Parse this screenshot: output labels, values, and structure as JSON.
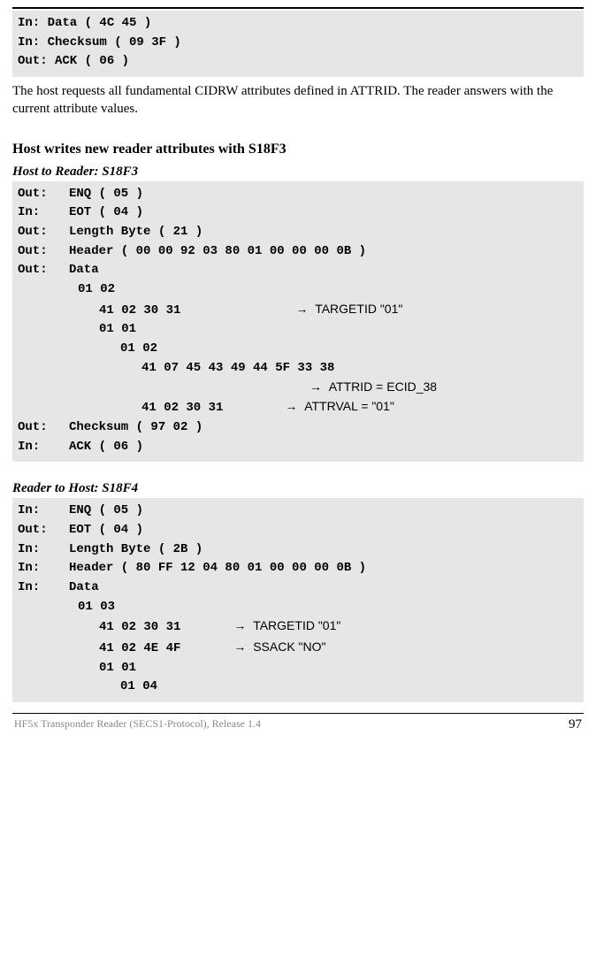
{
  "block1": {
    "l1": "In:  Data ( 4C 45 )",
    "l2": "In:  Checksum ( 09 3F )",
    "l3": "Out:  ACK ( 06 )"
  },
  "para1": "The host requests all fundamental CIDRW attributes defined in ATTRID. The reader answers with the current attribute values.",
  "sec2_title": "Host writes new reader attributes with S18F3",
  "sub2a": "Host to Reader: S18F3",
  "block2": {
    "r1_dir": "Out:",
    "r1_val": "ENQ ( 05 )",
    "r2_dir": "In:",
    "r2_val": "EOT ( 04 )",
    "r3_dir": "Out:",
    "r3_val": "Length Byte ( 21 )",
    "r4_dir": "Out:",
    "r4_val": "Header ( 00 00 92 03 80 01 00 00 00 0B )",
    "r5_dir": "Out:",
    "r5_val": "Data",
    "d1": "01 02",
    "d2": "41 02 30 31",
    "d2_annot": "TARGETID \"01\"",
    "d3": "01 01",
    "d4": "01 02",
    "d5": "41 07 45 43 49 44 5F 33 38",
    "d5_annot": "ATTRID = ECID_38",
    "d6": "41 02 30 31",
    "d6_annot": "ATTRVAL =  \"01\"",
    "r6_dir": "Out:",
    "r6_val": "Checksum ( 97 02 )",
    "r7_dir": "In:",
    "r7_val": "ACK ( 06 )"
  },
  "sub2b": "Reader to Host: S18F4",
  "block3": {
    "r1_dir": "In:",
    "r1_val": "ENQ ( 05 )",
    "r2_dir": "Out:",
    "r2_val": "EOT ( 04 )",
    "r3_dir": "In:",
    "r3_val": "Length Byte ( 2B )",
    "r4_dir": "In:",
    "r4_val": "Header ( 80 FF 12 04 80 01 00 00 00 0B )",
    "r5_dir": "In:",
    "r5_val": "Data",
    "d1": "01 03",
    "d2": "41 02 30 31",
    "d2_annot": "TARGETID \"01\"",
    "d3": "41 02 4E 4F",
    "d3_annot": "SSACK \"NO\"",
    "d4": "01 01",
    "d5": "01 04"
  },
  "footer": {
    "doc": "HF5x Transponder Reader (SECS1-Protocol), Release 1.4",
    "page": "97"
  },
  "arrow": "→"
}
